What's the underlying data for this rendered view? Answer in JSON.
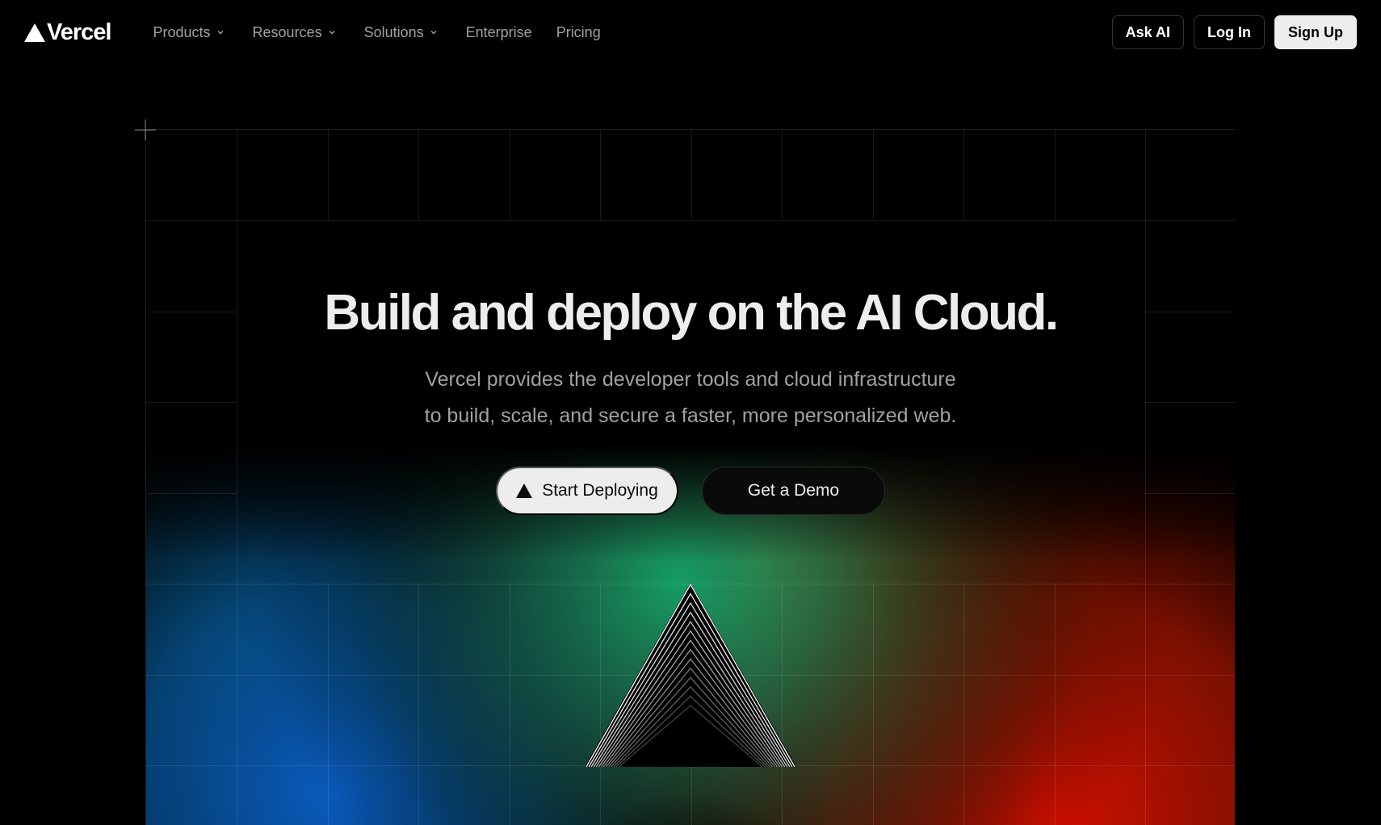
{
  "header": {
    "logo_text": "Vercel",
    "nav": [
      {
        "label": "Products",
        "has_dropdown": true
      },
      {
        "label": "Resources",
        "has_dropdown": true
      },
      {
        "label": "Solutions",
        "has_dropdown": true
      },
      {
        "label": "Enterprise",
        "has_dropdown": false
      },
      {
        "label": "Pricing",
        "has_dropdown": false
      }
    ],
    "ask_ai_label": "Ask AI",
    "login_label": "Log In",
    "signup_label": "Sign Up"
  },
  "hero": {
    "headline": "Build and deploy on the AI Cloud.",
    "subtitle_line1": "Vercel provides the developer tools and cloud infrastructure",
    "subtitle_line2": "to build, scale, and secure a faster, more personalized web.",
    "primary_cta": "Start Deploying",
    "secondary_cta": "Get a Demo"
  },
  "icons": {
    "logo": "vercel-triangle-icon",
    "dropdown": "chevron-down-icon",
    "cta": "vercel-triangle-icon",
    "crosshair": "plus-icon",
    "prism": "prism-triangle-graphic"
  },
  "colors": {
    "background": "#000000",
    "text_primary": "#ededed",
    "text_secondary": "#a1a1a1",
    "glow_green": "#0b8a5a",
    "glow_yellow": "#b08a12",
    "glow_blue": "#0a56b8",
    "glow_red": "#c40f00",
    "grid_line": "#1f1f1f"
  }
}
